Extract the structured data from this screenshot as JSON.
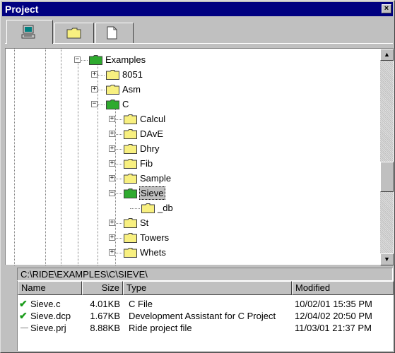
{
  "window": {
    "title": "Project"
  },
  "title_close_glyph": "×",
  "tabs": [
    {
      "name": "computer-icon",
      "active": true
    },
    {
      "name": "folder-icon",
      "active": false
    },
    {
      "name": "document-icon",
      "active": false
    }
  ],
  "tree": {
    "nodes": [
      {
        "label": "Examples",
        "expander": "⊟",
        "open": true,
        "color": "green"
      },
      {
        "label": "8051",
        "expander": "⊞"
      },
      {
        "label": "Asm",
        "expander": "⊞"
      },
      {
        "label": "C",
        "expander": "⊟",
        "open": true,
        "color": "green"
      },
      {
        "label": "Calcul",
        "expander": "⊞"
      },
      {
        "label": "DAvE",
        "expander": "⊞"
      },
      {
        "label": "Dhry",
        "expander": "⊞"
      },
      {
        "label": "Fib",
        "expander": "⊞"
      },
      {
        "label": "Sample",
        "expander": "⊞"
      },
      {
        "label": "Sieve",
        "expander": "⊟",
        "open": true,
        "selected": true,
        "color": "green"
      },
      {
        "label": "_db",
        "expander": ""
      },
      {
        "label": "St",
        "expander": "⊞"
      },
      {
        "label": "Towers",
        "expander": "⊞"
      },
      {
        "label": "Whets",
        "expander": "⊞"
      }
    ]
  },
  "scroll": {
    "up": "▲",
    "down": "▼"
  },
  "path": "C:\\RIDE\\EXAMPLES\\C\\SIEVE\\",
  "list": {
    "headers": {
      "name": "Name",
      "size": "Size",
      "type": "Type",
      "modified": "Modified"
    },
    "rows": [
      {
        "status": "check",
        "name": "Sieve.c",
        "size": "4.01KB",
        "type": "C File",
        "modified": "10/02/01 15:35 PM"
      },
      {
        "status": "check",
        "name": "Sieve.dcp",
        "size": "1.67KB",
        "type": "Development Assistant for C Project",
        "modified": "12/04/02 20:50 PM"
      },
      {
        "status": "none",
        "name": "Sieve.prj",
        "size": "8.88KB",
        "type": "Ride project file",
        "modified": "11/03/01 21:37 PM"
      }
    ]
  },
  "colors": {
    "titlebar": "#000080",
    "folder": "#f8f080",
    "folder_open": "#2eaa2e",
    "check": "#1a9b1a"
  }
}
